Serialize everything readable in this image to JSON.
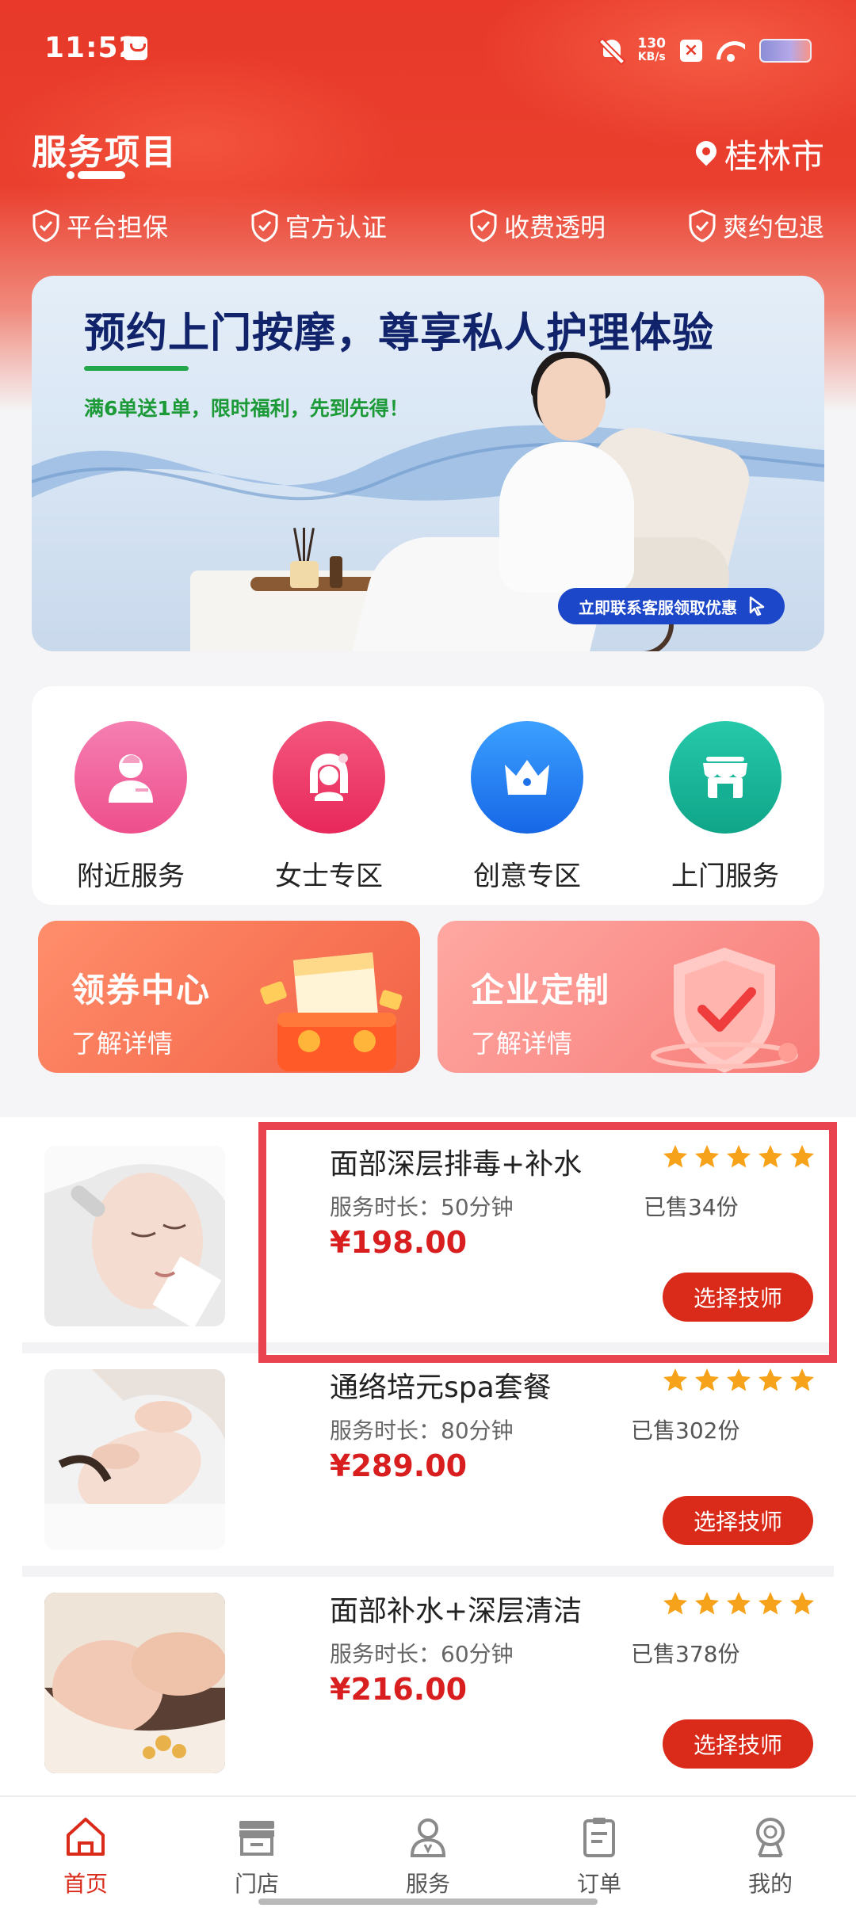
{
  "status_bar": {
    "time": "11:52",
    "net_speed_value": "130",
    "net_speed_unit": "KB/s"
  },
  "header": {
    "title": "服务项目",
    "location": "桂林市",
    "guarantees": [
      "平台担保",
      "官方认证",
      "收费透明",
      "爽约包退"
    ]
  },
  "banner": {
    "headline": "预约上门按摩，尊享私人护理体验",
    "subtitle": "满6单送1单，限时福利，先到先得！",
    "cta": "立即联系客服领取优惠"
  },
  "categories": [
    {
      "label": "附近服务",
      "icon": "nearby-service-icon",
      "color": "#f0609a"
    },
    {
      "label": "女士专区",
      "icon": "ladies-zone-icon",
      "color": "#ee3a68"
    },
    {
      "label": "创意专区",
      "icon": "crown-icon",
      "color": "#1b7ff0"
    },
    {
      "label": "上门服务",
      "icon": "storefront-icon",
      "color": "#17b59a"
    }
  ],
  "promos": [
    {
      "title": "领券中心",
      "subtitle": "了解详情"
    },
    {
      "title": "企业定制",
      "subtitle": "了解详情"
    }
  ],
  "services": [
    {
      "name": "面部深层排毒+补水",
      "duration": "服务时长：50分钟",
      "sold": "已售34份",
      "price": "¥198.00",
      "rating": 5,
      "button": "选择技师"
    },
    {
      "name": "通络培元spa套餐",
      "duration": "服务时长：80分钟",
      "sold": "已售302份",
      "price": "¥289.00",
      "rating": 5,
      "button": "选择技师"
    },
    {
      "name": "面部补水+深层清洁",
      "duration": "服务时长：60分钟",
      "sold": "已售378份",
      "price": "¥216.00",
      "rating": 5,
      "button": "选择技师"
    }
  ],
  "bottom_nav": [
    {
      "label": "首页",
      "icon": "home-icon",
      "active": true
    },
    {
      "label": "门店",
      "icon": "store-icon",
      "active": false
    },
    {
      "label": "服务",
      "icon": "person-service-icon",
      "active": false
    },
    {
      "label": "订单",
      "icon": "clipboard-icon",
      "active": false
    },
    {
      "label": "我的",
      "icon": "profile-icon",
      "active": false
    }
  ],
  "colors": {
    "brand_red": "#e8392a",
    "price_red": "#d81e1e",
    "star_orange": "#f7a21b",
    "highlight_border": "#e8434e"
  }
}
